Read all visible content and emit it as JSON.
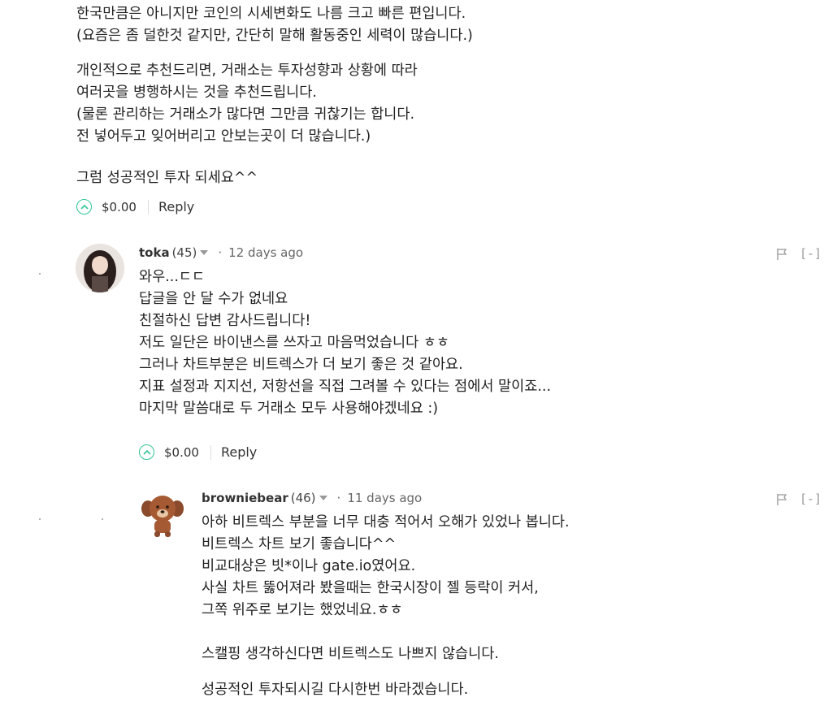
{
  "comment1": {
    "paragraphs": [
      "한국만큼은 아니지만 코인의 시세변화도 나름 크고 빠른 편입니다.\n(요즘은 좀 덜한것 같지만, 간단히 말해 활동중인 세력이 많습니다.)",
      "개인적으로 추천드리면, 거래소는 투자성향과 상황에 따라\n여러곳을 병행하시는 것을 추천드립니다.\n(물론 관리하는 거래소가 많다면 그만큼 귀찮기는 합니다.\n전 넣어두고 잊어버리고 안보는곳이 더 많습니다.)",
      "그럼 성공적인 투자 되세요^^"
    ],
    "payout": "$0.00",
    "reply_label": "Reply"
  },
  "comment2": {
    "author": "toka",
    "reputation": "(45)",
    "time": "12 days ago",
    "collapse_label": "[-]",
    "body": "와우...ㄷㄷ\n답글을 안 달 수가 없네요\n친절하신 답변 감사드립니다!\n저도 일단은 바이낸스를 쓰자고 마음먹었습니다 ㅎㅎ\n그러나 차트부분은 비트렉스가 더 보기 좋은 것 같아요.\n지표 설정과 지지선, 저항선을 직접 그려볼 수 있다는 점에서 말이죠...\n마지막 말씀대로 두 거래소 모두 사용해야겠네요 :)",
    "payout": "$0.00",
    "reply_label": "Reply"
  },
  "comment3": {
    "author": "browniebear",
    "reputation": "(46)",
    "time": "11 days ago",
    "collapse_label": "[-]",
    "paragraphs": [
      "아하 비트렉스 부분을 너무 대충 적어서 오해가 있었나 봅니다.\n비트렉스 차트 보기 좋습니다^^\n비교대상은 빗*이나 gate.io였어요.\n사실 차트 뚫어져라 봤을때는 한국시장이 젤 등락이 커서,\n그쪽 위주로 보기는 했었네요.ㅎㅎ",
      "스캘핑 생각하신다면 비트렉스도 나쁘지 않습니다.",
      "성공적인 투자되시길 다시한번 바라겠습니다."
    ]
  },
  "colors": {
    "upvote": "#2fc495",
    "text": "#222222",
    "muted": "#666666"
  },
  "icons": [
    "chevron-up-icon",
    "flag-icon",
    "avatar-toka",
    "avatar-browniebear"
  ]
}
